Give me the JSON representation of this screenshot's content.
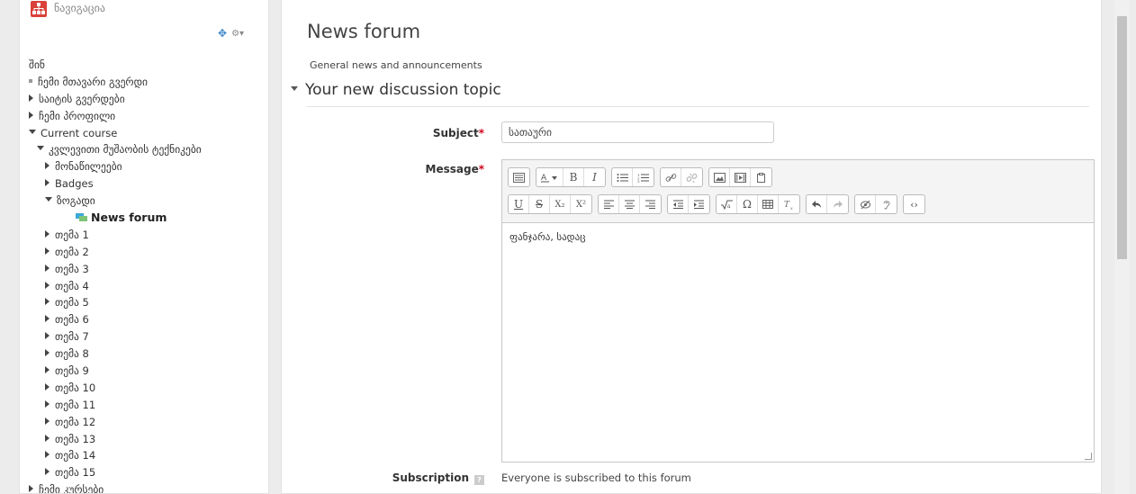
{
  "nav": {
    "title": "ნავიგაცია",
    "items": [
      {
        "text": "შინ",
        "icon": "none",
        "level": 0
      },
      {
        "text": "ჩემი მთავარი გვერდი",
        "icon": "bullet",
        "level": 0
      },
      {
        "text": "საიტის გვერდები",
        "icon": "triangle-right",
        "level": 0
      },
      {
        "text": "ჩემი პროფილი",
        "icon": "triangle-right",
        "level": 0
      },
      {
        "text": "Current course",
        "icon": "triangle-down",
        "level": 0
      },
      {
        "text": "კვლევითი მუშაობის ტექნიკები",
        "icon": "triangle-down",
        "level": 1
      },
      {
        "text": "მონაწილეები",
        "icon": "triangle-right",
        "level": 2
      },
      {
        "text": "Badges",
        "icon": "triangle-right",
        "level": 2
      },
      {
        "text": "ზოგადი",
        "icon": "triangle-down",
        "level": 2
      },
      {
        "text": "News forum",
        "icon": "forum",
        "level": 3
      },
      {
        "text": "თემა 1",
        "icon": "triangle-right",
        "level": 2
      },
      {
        "text": "თემა 2",
        "icon": "triangle-right",
        "level": 2
      },
      {
        "text": "თემა 3",
        "icon": "triangle-right",
        "level": 2
      },
      {
        "text": "თემა 4",
        "icon": "triangle-right",
        "level": 2
      },
      {
        "text": "თემა 5",
        "icon": "triangle-right",
        "level": 2
      },
      {
        "text": "თემა 6",
        "icon": "triangle-right",
        "level": 2
      },
      {
        "text": "თემა 7",
        "icon": "triangle-right",
        "level": 2
      },
      {
        "text": "თემა 8",
        "icon": "triangle-right",
        "level": 2
      },
      {
        "text": "თემა 9",
        "icon": "triangle-right",
        "level": 2
      },
      {
        "text": "თემა 10",
        "icon": "triangle-right",
        "level": 2
      },
      {
        "text": "თემა 11",
        "icon": "triangle-right",
        "level": 2
      },
      {
        "text": "თემა 12",
        "icon": "triangle-right",
        "level": 2
      },
      {
        "text": "თემა 13",
        "icon": "triangle-right",
        "level": 2
      },
      {
        "text": "თემა 14",
        "icon": "triangle-right",
        "level": 2
      },
      {
        "text": "თემა 15",
        "icon": "triangle-right",
        "level": 2
      },
      {
        "text": "ჩემი კურსები",
        "icon": "triangle-right",
        "level": 0
      }
    ]
  },
  "main": {
    "title": "News forum",
    "intro": "General news and announcements",
    "legend": "Your new discussion topic",
    "subject_label": "Subject",
    "subject_value": "სათაური",
    "message_label": "Message",
    "message_content": "ფანჯარა, სადაც",
    "subscription_label": "Subscription",
    "subscription_value": "Everyone is subscribed to this forum",
    "required_mark": "*"
  },
  "toolbar": {
    "row1": [
      [
        "toggle-toolbar-icon"
      ],
      [
        "font-color-icon",
        "bold-icon",
        "italic-icon"
      ],
      [
        "unordered-list-icon",
        "ordered-list-icon"
      ],
      [
        "link-icon",
        "unlink-icon"
      ],
      [
        "image-icon",
        "media-icon",
        "manage-files-icon"
      ]
    ],
    "row2": [
      [
        "underline-icon",
        "strikethrough-icon",
        "subscript-icon",
        "superscript-icon"
      ],
      [
        "align-left-icon",
        "align-center-icon",
        "align-right-icon"
      ],
      [
        "outdent-icon",
        "indent-icon"
      ],
      [
        "equation-icon",
        "special-char-icon",
        "table-icon",
        "clear-format-icon"
      ],
      [
        "undo-icon",
        "redo-icon"
      ],
      [
        "accessibility-icon",
        "screenreader-icon"
      ],
      [
        "html-icon"
      ]
    ],
    "glyphs": {
      "bold": "B",
      "italic": "I",
      "underline": "U",
      "strikethrough": "S",
      "subscript": "X₂",
      "superscript": "X²",
      "omega": "Ω",
      "html": "‹›"
    }
  },
  "colors": {
    "logo": "#d9413a",
    "required": "#d0021b",
    "forum_icon": "#3aa8d8"
  }
}
